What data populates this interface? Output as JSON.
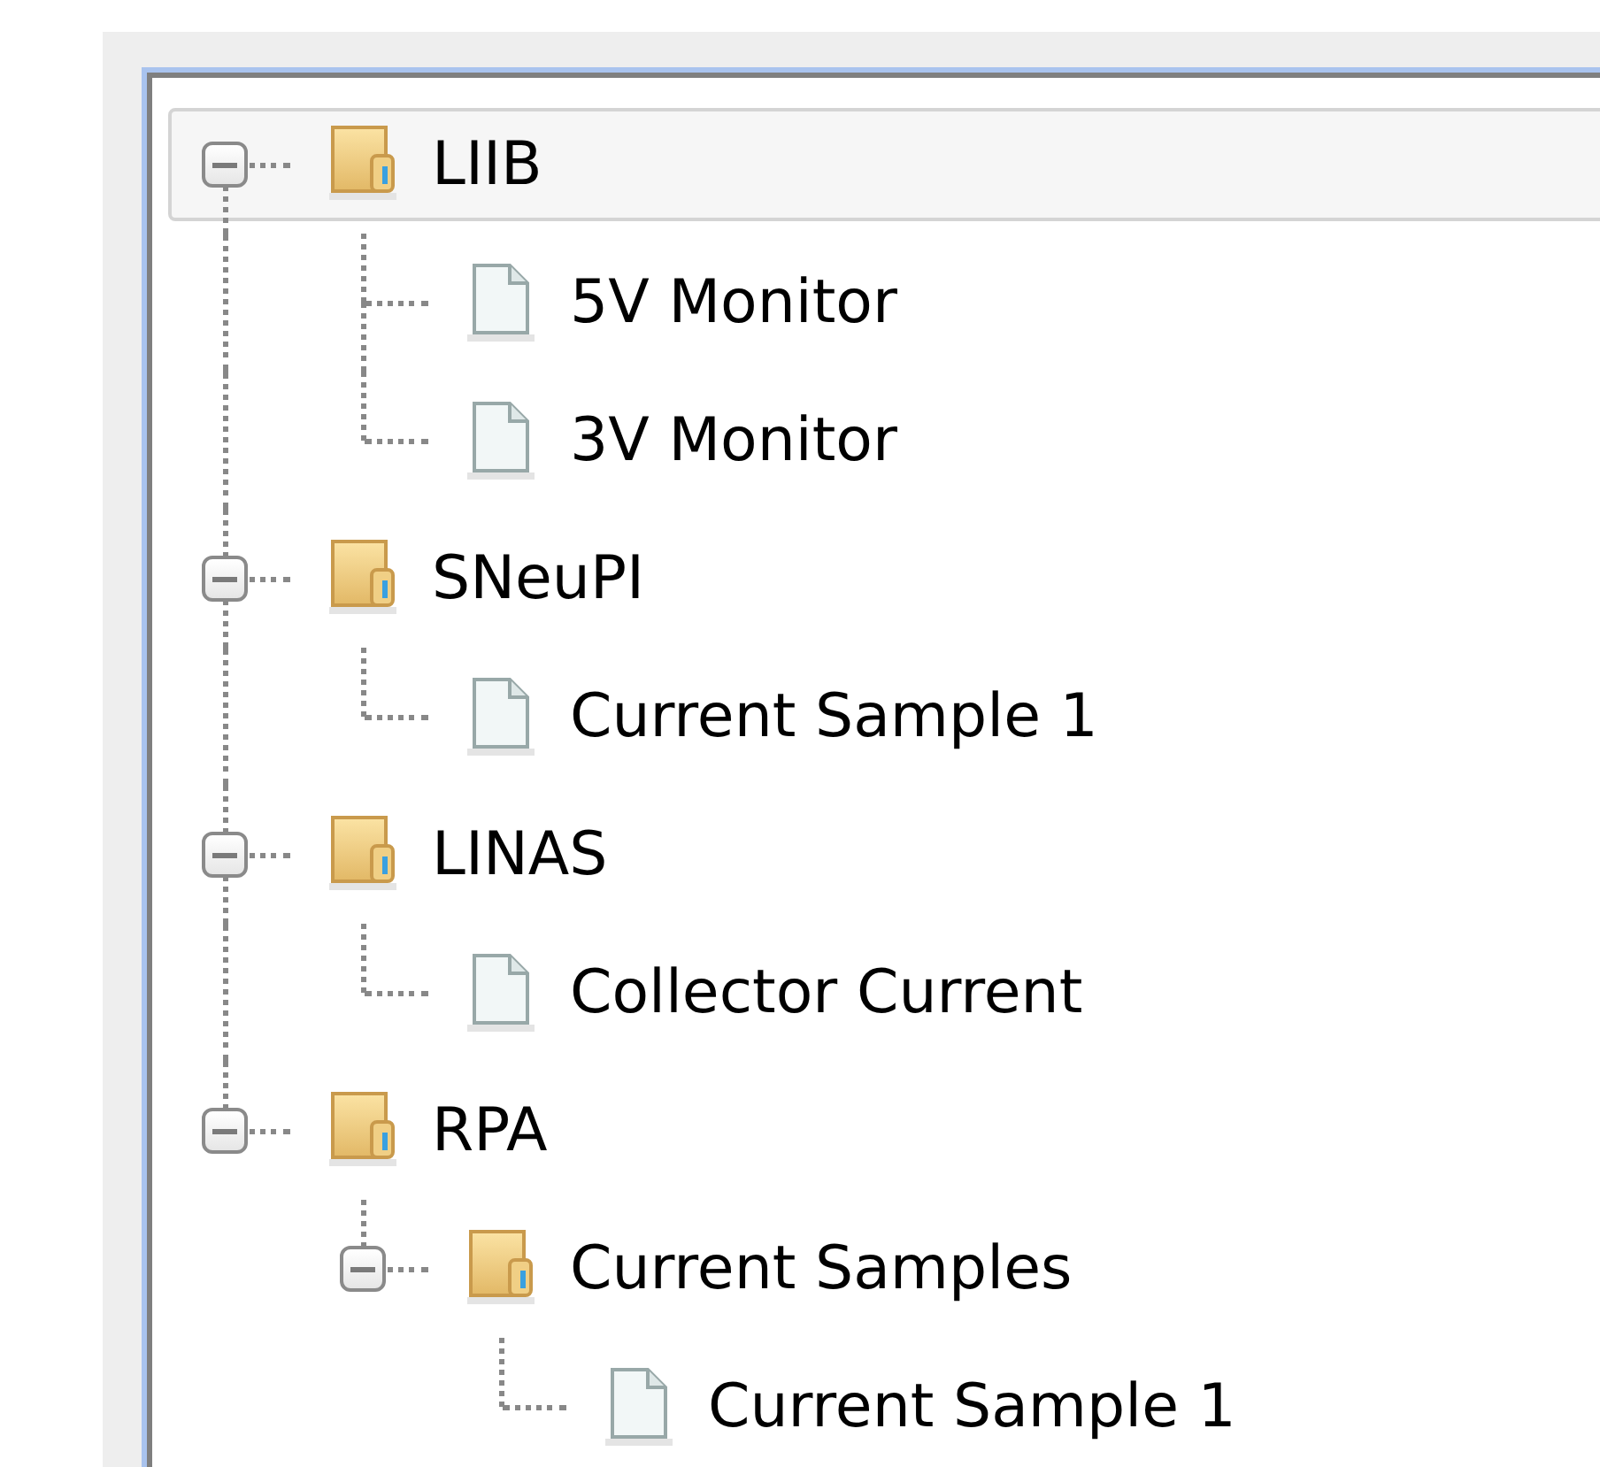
{
  "tree": [
    {
      "label": "LIIB",
      "kind": "folder",
      "expanded": true,
      "selected": true,
      "children": [
        {
          "label": "5V Monitor",
          "kind": "file",
          "selected": false
        },
        {
          "label": "3V Monitor",
          "kind": "file",
          "selected": false
        }
      ]
    },
    {
      "label": "SNeuPI",
      "kind": "folder",
      "expanded": true,
      "selected": false,
      "children": [
        {
          "label": "Current Sample 1",
          "kind": "file",
          "selected": false
        }
      ]
    },
    {
      "label": "LINAS",
      "kind": "folder",
      "expanded": true,
      "selected": false,
      "children": [
        {
          "label": "Collector Current",
          "kind": "file",
          "selected": false
        }
      ]
    },
    {
      "label": "RPA",
      "kind": "folder",
      "expanded": true,
      "selected": false,
      "children": [
        {
          "label": "Current Samples",
          "kind": "folder",
          "expanded": true,
          "selected": false,
          "children": [
            {
              "label": "Current Sample 1",
              "kind": "file",
              "selected": false
            }
          ]
        }
      ]
    }
  ]
}
